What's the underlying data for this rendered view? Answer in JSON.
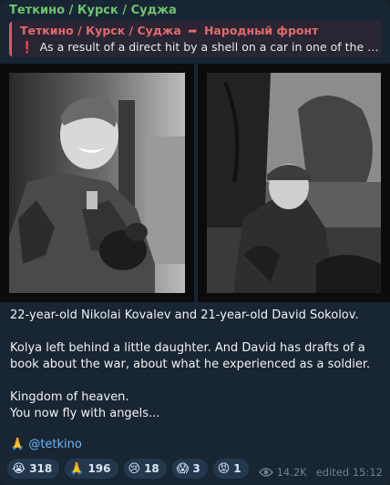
{
  "channel": {
    "name": "Теткино / Курск / Суджа"
  },
  "reply": {
    "source": "Теткино / Курск / Суджа",
    "arrow": "➦",
    "target": "Народный фронт",
    "mark": "❗",
    "text": "As a result of a direct hit by a shell on a car in one of the b..."
  },
  "message": {
    "line1": "22-year-old Nikolai Kovalev and 21-year-old David Sokolov.",
    "line2": "Kolya left behind a little daughter. And David has drafts of a book about the war, about what he experienced as a soldier.",
    "line3a": "Kingdom of heaven.",
    "line3b": "You now fly with angels...",
    "sig_emoji": "🙏",
    "sig_link": "@tetkino"
  },
  "reactions": [
    {
      "emoji": "😭",
      "count": "318"
    },
    {
      "emoji": "🙏",
      "count": "196"
    },
    {
      "emoji": "😢",
      "count": "18"
    },
    {
      "emoji": "😱",
      "count": "3"
    },
    {
      "emoji": "😡",
      "count": "1"
    }
  ],
  "meta": {
    "views": "14.2K",
    "edited": "edited 15:12"
  }
}
